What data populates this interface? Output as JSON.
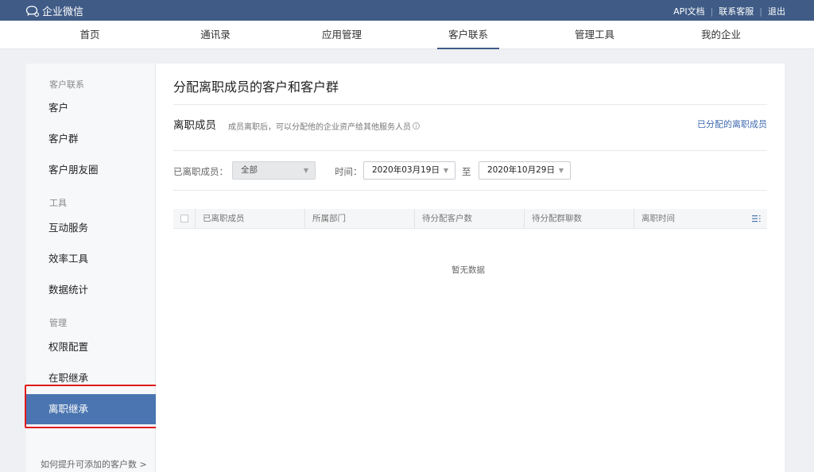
{
  "app": {
    "name": "企业微信"
  },
  "toplinks": {
    "api_docs": "API文档",
    "support": "联系客服",
    "logout": "退出"
  },
  "nav": {
    "items": [
      {
        "label": "首页"
      },
      {
        "label": "通讯录"
      },
      {
        "label": "应用管理"
      },
      {
        "label": "客户联系",
        "active": true
      },
      {
        "label": "管理工具"
      },
      {
        "label": "我的企业"
      }
    ]
  },
  "sidebar": {
    "sections": [
      {
        "title": "客户联系",
        "items": [
          "客户",
          "客户群",
          "客户朋友圈"
        ]
      },
      {
        "title": "工具",
        "items": [
          "互动服务",
          "效率工具",
          "数据统计"
        ]
      },
      {
        "title": "管理",
        "items": [
          "权限配置",
          "在职继承",
          "离职继承"
        ]
      }
    ],
    "active_item": "离职继承",
    "footer": "如何提升可添加的客户数 >"
  },
  "main": {
    "title": "分配离职成员的客户和客户群",
    "section_title": "离职成员",
    "section_desc": "成员离职后，可以分配他的企业资产给其他服务人员",
    "assigned_link": "已分配的离职成员",
    "filters": {
      "member_label": "已离职成员：",
      "member_value": "全部",
      "time_label": "时间：",
      "start_date": "2020年03月19日",
      "to_label": "至",
      "end_date": "2020年10月29日"
    },
    "table": {
      "columns": [
        "已离职成员",
        "所属部门",
        "待分配客户数",
        "待分配群聊数",
        "离职时间"
      ],
      "rows": [],
      "empty_text": "暂无数据"
    }
  },
  "colors": {
    "topbar": "#3f5b86",
    "active_sidebar": "#4a75b0",
    "link": "#3f6ab0",
    "highlight": "#e01b1b"
  }
}
